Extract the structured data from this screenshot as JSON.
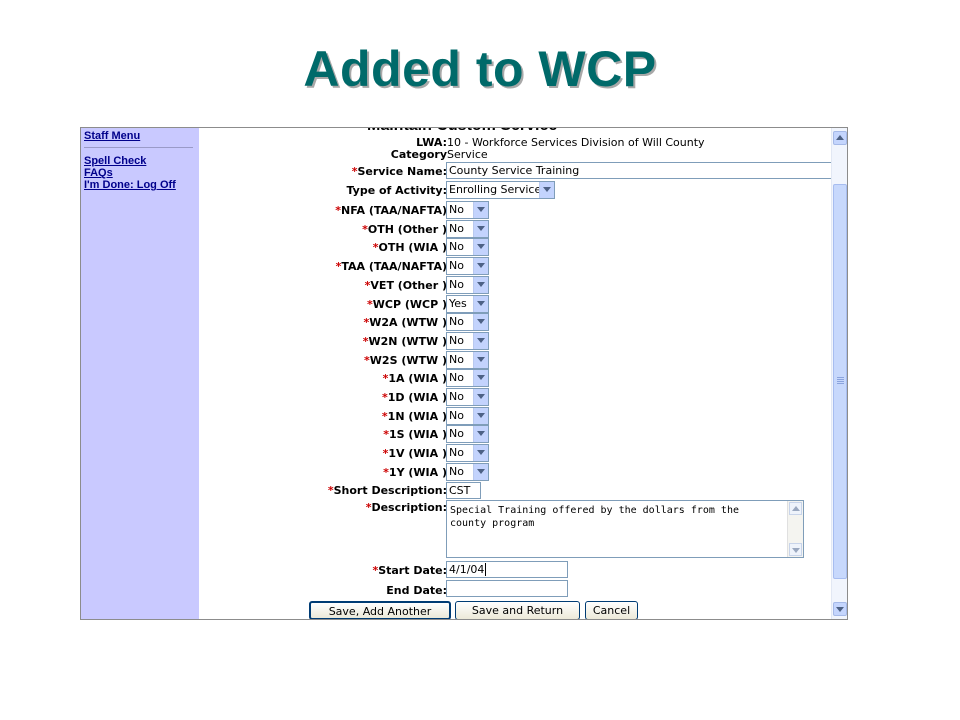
{
  "slide_title": "Added to WCP",
  "sidebar": {
    "staff_menu": "Staff Menu",
    "links": [
      "Spell Check",
      "FAQs",
      "I'm Done: Log Off"
    ]
  },
  "page_heading": "Maintain Custom Service",
  "info": {
    "lwa_label": "LWA:",
    "lwa_value": "10 - Workforce Services Division of Will County",
    "category_label": "Category",
    "category_value": "Service"
  },
  "fields": {
    "service_name_label": "Service Name:",
    "service_name_value": "County Service Training",
    "activity_label": "Type of Activity:",
    "activity_value": "Enrolling Service",
    "short_desc_label": "Short Description:",
    "short_desc_value": "CST",
    "description_label": "Description:",
    "description_value": "Special Training offered by the dollars from the county program",
    "start_date_label": "Start Date:",
    "start_date_value": "4/1/04",
    "end_date_label": "End Date:",
    "end_date_value": ""
  },
  "funding_fields": [
    {
      "label": "NFA (TAA/NAFTA)",
      "value": "No"
    },
    {
      "label": "OTH (Other )",
      "value": "No"
    },
    {
      "label": "OTH (WIA )",
      "value": "No"
    },
    {
      "label": "TAA (TAA/NAFTA)",
      "value": "No"
    },
    {
      "label": "VET (Other )",
      "value": "No"
    },
    {
      "label": "WCP (WCP )",
      "value": "Yes"
    },
    {
      "label": "W2A (WTW )",
      "value": "No"
    },
    {
      "label": "W2N (WTW )",
      "value": "No"
    },
    {
      "label": "W2S (WTW )",
      "value": "No"
    },
    {
      "label": "1A (WIA )",
      "value": "No"
    },
    {
      "label": "1D (WIA )",
      "value": "No"
    },
    {
      "label": "1N (WIA )",
      "value": "No"
    },
    {
      "label": "1S (WIA )",
      "value": "No"
    },
    {
      "label": "1V (WIA )",
      "value": "No"
    },
    {
      "label": "1Y (WIA )",
      "value": "No"
    }
  ],
  "required_mark": "*",
  "buttons": {
    "save_add": "Save, Add Another",
    "save_return": "Save and Return",
    "cancel": "Cancel"
  },
  "colors": {
    "title": "#006a6a",
    "sidebar_bg": "#c9c9ff",
    "required": "#cc0000",
    "link": "#00008b"
  },
  "icons": {
    "dropdown": "chevron-down-icon",
    "scroll_up": "arrow-up-icon",
    "scroll_down": "arrow-down-icon"
  }
}
